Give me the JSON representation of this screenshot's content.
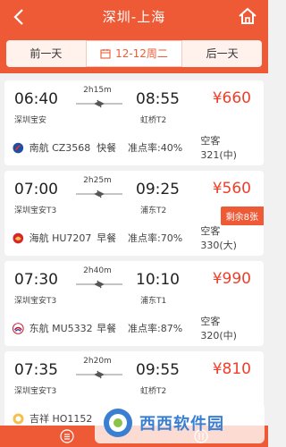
{
  "header": {
    "title": "深圳-上海",
    "prev_day": "前一天",
    "current_date": "12-12周二",
    "next_day": "后一天"
  },
  "flights": [
    {
      "dep_time": "06:40",
      "arr_time": "08:55",
      "duration": "2h15m",
      "dep_airport": "深圳宝安",
      "arr_airport": "虹桥T2",
      "price": "¥660",
      "airline": "南航 CZ3568",
      "meal": "快餐",
      "on_time": "准点率:40%",
      "aircraft": "空客321(中)",
      "badge": "",
      "logo": "china-southern-logo-icon"
    },
    {
      "dep_time": "07:00",
      "arr_time": "09:25",
      "duration": "2h25m",
      "dep_airport": "深圳宝安T3",
      "arr_airport": "浦东T2",
      "price": "¥560",
      "airline": "海航 HU7207",
      "meal": "早餐",
      "on_time": "准点率:70%",
      "aircraft": "空客330(大)",
      "badge": "剩余8张",
      "logo": "hainan-airlines-logo-icon"
    },
    {
      "dep_time": "07:30",
      "arr_time": "10:10",
      "duration": "2h40m",
      "dep_airport": "深圳宝安T3",
      "arr_airport": "浦东T1",
      "price": "¥990",
      "airline": "东航 MU5332",
      "meal": "早餐",
      "on_time": "准点率:87%",
      "aircraft": "空客320(中)",
      "badge": "",
      "logo": "china-eastern-logo-icon"
    },
    {
      "dep_time": "07:35",
      "arr_time": "09:55",
      "duration": "2h20m",
      "dep_airport": "深圳宝安T3",
      "arr_airport": "虹桥T2",
      "price": "¥810",
      "airline": "吉祥 HO1152",
      "meal": "",
      "on_time": "",
      "aircraft": "",
      "badge": "",
      "logo": "juneyao-logo-icon"
    }
  ],
  "watermark": {
    "text": "西西软件园"
  },
  "colors": {
    "brand": "#ef5a36",
    "price": "#ef3e2a"
  },
  "icons": {
    "back": "back-arrow-icon",
    "home": "home-icon",
    "calendar": "calendar-icon",
    "plane": "plane-icon",
    "footer_left": "list-icon",
    "footer_right": "filter-icon"
  }
}
